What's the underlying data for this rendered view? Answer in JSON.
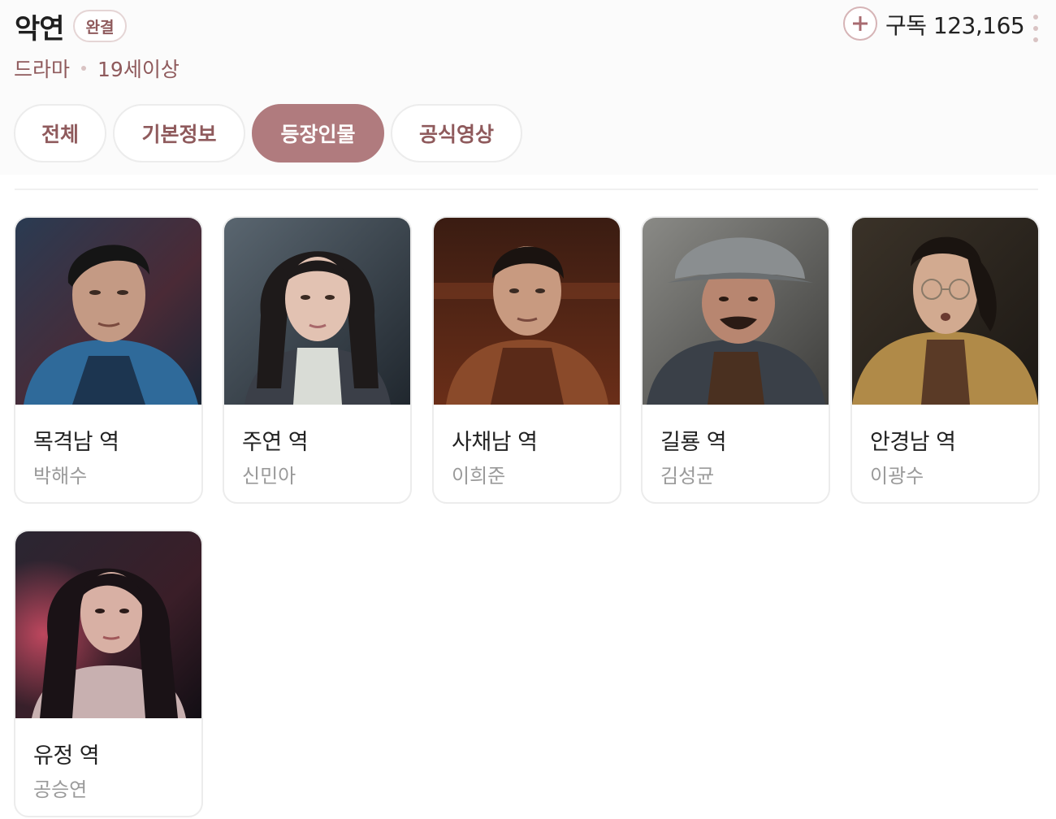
{
  "header": {
    "title": "악연",
    "status_badge": "완결",
    "genre": "드라마",
    "rating": "19세이상",
    "subscribe_label": "구독",
    "subscribe_count": "123,165",
    "subscribe_text": "구독 123,165"
  },
  "tabs": [
    {
      "label": "전체",
      "active": false
    },
    {
      "label": "기본정보",
      "active": false
    },
    {
      "label": "등장인물",
      "active": true
    },
    {
      "label": "공식영상",
      "active": false
    }
  ],
  "cast": [
    {
      "role": "목격남 역",
      "actor": "박해수",
      "photo": "portrait-blue-jacket"
    },
    {
      "role": "주연 역",
      "actor": "신민아",
      "photo": "portrait-white-turtleneck"
    },
    {
      "role": "사채남 역",
      "actor": "이희준",
      "photo": "portrait-brown-jacket"
    },
    {
      "role": "길룡 역",
      "actor": "김성균",
      "photo": "portrait-bucket-hat"
    },
    {
      "role": "안경남 역",
      "actor": "이광수",
      "photo": "portrait-glasses-camel-coat"
    },
    {
      "role": "유정 역",
      "actor": "공승연",
      "photo": "portrait-dark-hair-red-light"
    }
  ],
  "colors": {
    "accent": "#b07b7e",
    "accent_text": "#8f5a5c",
    "badge_border": "#e5d5d5",
    "muted_text": "#9a9a9a"
  },
  "icons": [
    "plus-icon",
    "more-vertical-icon"
  ]
}
